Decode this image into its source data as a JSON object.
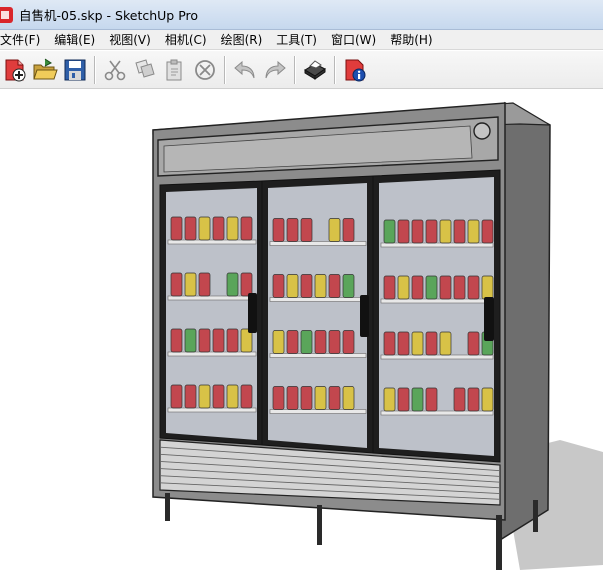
{
  "window": {
    "title": "自售机-05.skp - SketchUp Pro",
    "icon": "sketchup-icon"
  },
  "menu": [
    {
      "label": "文件(F)",
      "id": "file"
    },
    {
      "label": "编辑(E)",
      "id": "edit"
    },
    {
      "label": "视图(V)",
      "id": "view"
    },
    {
      "label": "相机(C)",
      "id": "camera"
    },
    {
      "label": "绘图(R)",
      "id": "draw"
    },
    {
      "label": "工具(T)",
      "id": "tools"
    },
    {
      "label": "窗口(W)",
      "id": "window"
    },
    {
      "label": "帮助(H)",
      "id": "help"
    }
  ],
  "toolbar": {
    "buttons": [
      {
        "id": "new",
        "icon": "new-file-icon"
      },
      {
        "id": "open",
        "icon": "open-folder-icon"
      },
      {
        "id": "save",
        "icon": "save-disk-icon"
      },
      {
        "id": "cut",
        "icon": "scissors-icon"
      },
      {
        "id": "copy",
        "icon": "copy-icon"
      },
      {
        "id": "paste",
        "icon": "paste-icon"
      },
      {
        "id": "erase",
        "icon": "erase-icon"
      },
      {
        "id": "undo",
        "icon": "undo-icon"
      },
      {
        "id": "redo",
        "icon": "redo-icon"
      },
      {
        "id": "print",
        "icon": "printer-icon"
      },
      {
        "id": "model-info",
        "icon": "model-info-icon"
      }
    ]
  },
  "colors": {
    "title_bar": "#c6d8ee",
    "menu_bar": "#f0f0f0",
    "fridge_body": "#8c8c8c",
    "fridge_frame": "#2a2a2a",
    "glass": "#b9bdc6",
    "can_red": "#c2474e",
    "can_green": "#5aa55a",
    "can_yellow": "#d8c247"
  }
}
